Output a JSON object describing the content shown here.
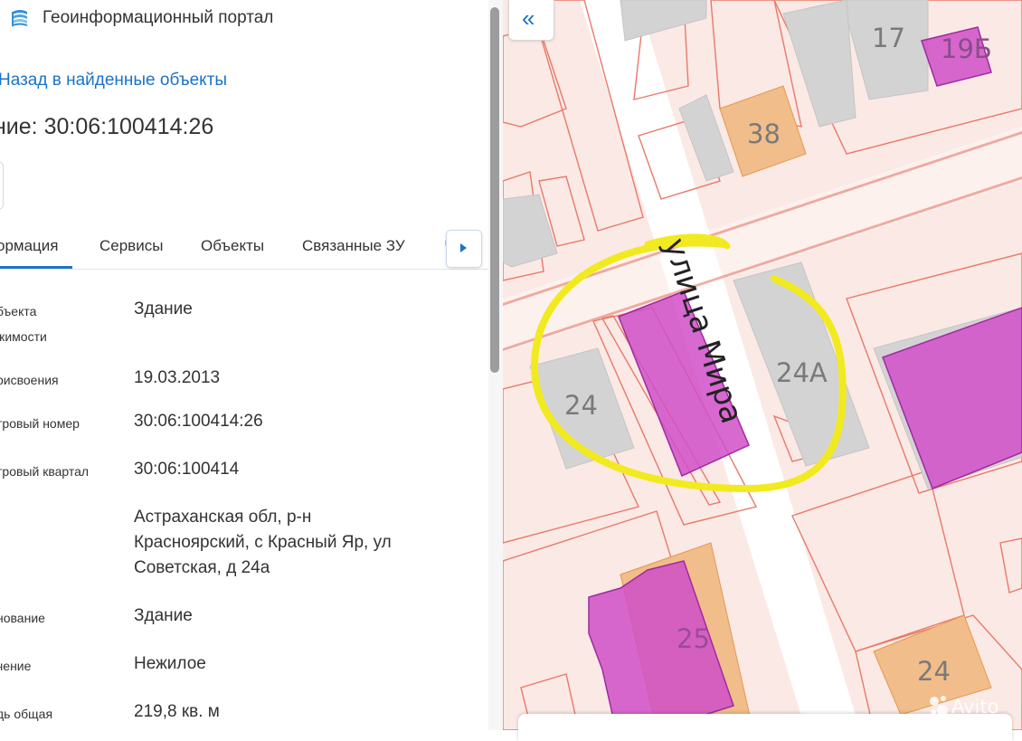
{
  "app": {
    "title": "Геоинформационный портал",
    "logo_icon": "stacked-layers-logo"
  },
  "back_link": "Назад в найденные объекты",
  "object_title": "ние: 30:06:100414:26",
  "tabs": {
    "items": [
      {
        "label": "ормация",
        "active": true
      },
      {
        "label": "Сервисы",
        "active": false
      },
      {
        "label": "Объекты",
        "active": false
      },
      {
        "label": "Связанные ЗУ",
        "active": false
      },
      {
        "label": "Ч",
        "active": false
      }
    ],
    "next_icon": "caret-right-icon"
  },
  "properties": [
    {
      "label": "бъекта",
      "label2": "жимости",
      "value": "Здание"
    },
    {
      "label": "рисвоения",
      "value": "19.03.2013"
    },
    {
      "label": "тровый номер",
      "value": "30:06:100414:26"
    },
    {
      "label": "тровый квартал",
      "value": "30:06:100414"
    },
    {
      "label": "",
      "value": "Астраханская обл, р-н",
      "value2": "Красноярский, с Красный Яр, ул",
      "value3": "Советская, д 24а"
    },
    {
      "label": "нование",
      "value": "Здание"
    },
    {
      "label": "чение",
      "value": "Нежилое"
    },
    {
      "label": "дь общая",
      "value": "219,8 кв. м"
    }
  ],
  "map": {
    "collapse_icon": "double-chevron-left-icon",
    "street_label": "улица Мира",
    "building_labels": [
      "17",
      "19Б",
      "38",
      "24",
      "24А",
      "25",
      "24"
    ],
    "watermark": "Avito",
    "colors": {
      "parcel_fill": "#fbe9e5",
      "parcel_stroke": "#e8796a",
      "building_grey": "#d3d3d3",
      "building_orange": "#f1bd8a",
      "highlight_magenta": "#d04fc8",
      "road": "#ffffff",
      "circle": "#f1ea20"
    }
  },
  "colors": {
    "accent": "#1a73c9",
    "text": "#333333"
  }
}
